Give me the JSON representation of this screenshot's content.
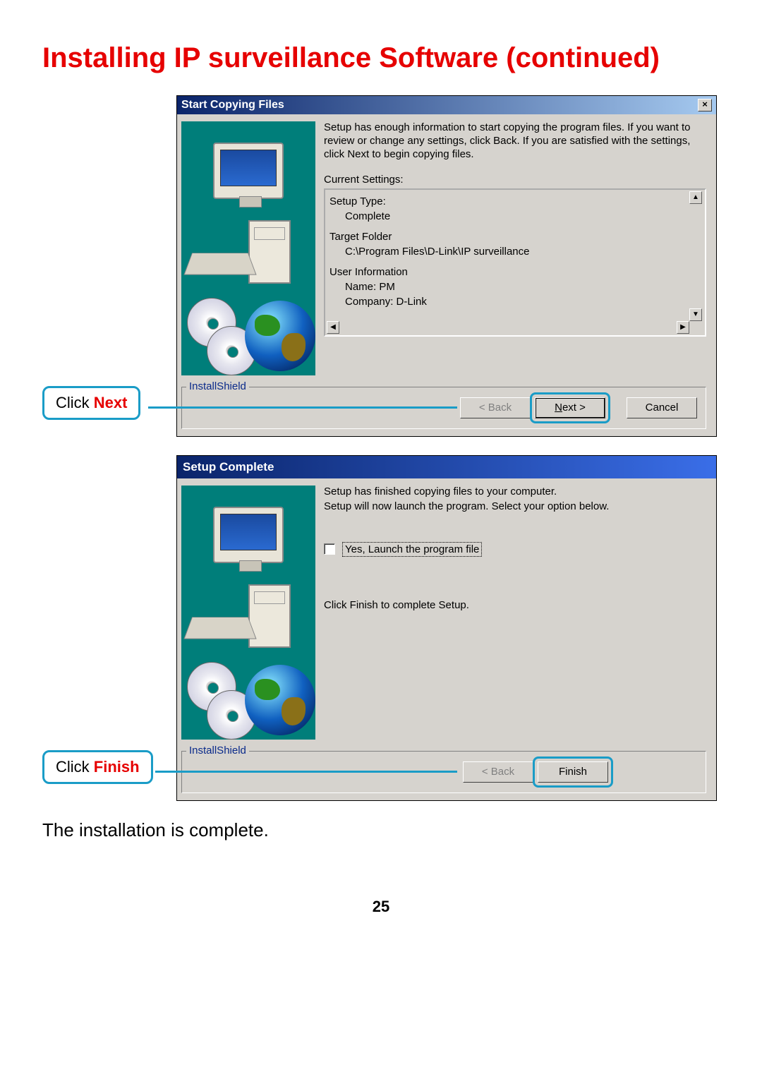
{
  "page": {
    "title": "Installing IP surveillance Software (continued)",
    "footer": "The installation is complete.",
    "number": "25"
  },
  "callouts": {
    "next_prefix": "Click ",
    "next_action": "Next",
    "finish_prefix": "Click ",
    "finish_action": "Finish"
  },
  "dialog1": {
    "title": "Start Copying Files",
    "close": "×",
    "intro": "Setup has enough information to start copying the program files. If you want to review or change any settings, click Back.  If you are satisfied with the settings, click Next to begin copying files.",
    "settings_label": "Current Settings:",
    "settings": {
      "setup_type_label": "Setup Type:",
      "setup_type_value": "Complete",
      "target_folder_label": "Target Folder",
      "target_folder_value": "C:\\Program Files\\D-Link\\IP surveillance",
      "user_info_label": "User Information",
      "user_name": "Name: PM",
      "user_company": "Company: D-Link"
    },
    "legend": "InstallShield",
    "buttons": {
      "back": "< Back",
      "next_prefix": "N",
      "next_rest": "ext >",
      "cancel": "Cancel"
    },
    "scroll": {
      "up": "▲",
      "down": "▼",
      "left": "◀",
      "right": "▶"
    }
  },
  "dialog2": {
    "title": "Setup Complete",
    "intro1": "Setup has finished copying files to your computer.",
    "intro2": "Setup will now launch the program. Select your option below.",
    "checkbox_label": "Yes, Launch the program file",
    "finish_hint": "Click Finish to complete Setup.",
    "legend": "InstallShield",
    "buttons": {
      "back": "< Back",
      "finish": "Finish"
    }
  }
}
